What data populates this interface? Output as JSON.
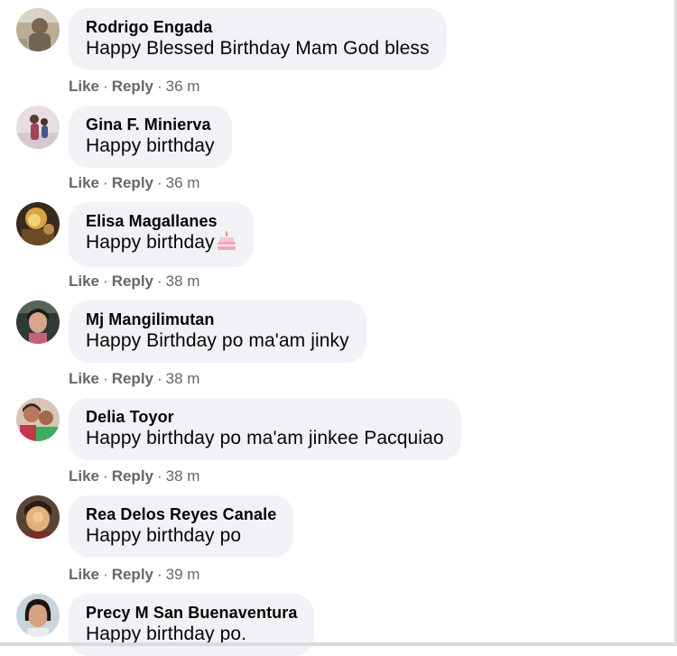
{
  "comments": [
    {
      "author": "Rodrigo Engada",
      "text": "Happy Blessed Birthday Mam God bless",
      "like": "Like",
      "reply": "Reply",
      "time": "36 m",
      "avatar": "avatar-rodrigo"
    },
    {
      "author": "Gina F. Minierva",
      "text": "Happy birthday",
      "like": "Like",
      "reply": "Reply",
      "time": "36 m",
      "avatar": "avatar-gina"
    },
    {
      "author": "Elisa Magallanes",
      "text": "Happy birthday",
      "emoji": "birthday-cake-icon",
      "like": "Like",
      "reply": "Reply",
      "time": "38 m",
      "avatar": "avatar-elisa"
    },
    {
      "author": "Mj Mangilimutan",
      "text": "Happy Birthday po ma'am jinky",
      "like": "Like",
      "reply": "Reply",
      "time": "38 m",
      "avatar": "avatar-mj"
    },
    {
      "author": "Delia Toyor",
      "text": "Happy birthday po ma'am jinkee Pacquiao",
      "like": "Like",
      "reply": "Reply",
      "time": "38 m",
      "avatar": "avatar-delia"
    },
    {
      "author": "Rea Delos Reyes Canale",
      "text": "Happy birthday po",
      "like": "Like",
      "reply": "Reply",
      "time": "39 m",
      "avatar": "avatar-rea"
    },
    {
      "author": "Precy M San Buenaventura",
      "text": "Happy birthday po.",
      "avatar": "avatar-precy"
    }
  ],
  "separator": "·",
  "colors": {
    "bubble": "#f0f2f5",
    "name": "#050505",
    "meta": "#65676b"
  }
}
